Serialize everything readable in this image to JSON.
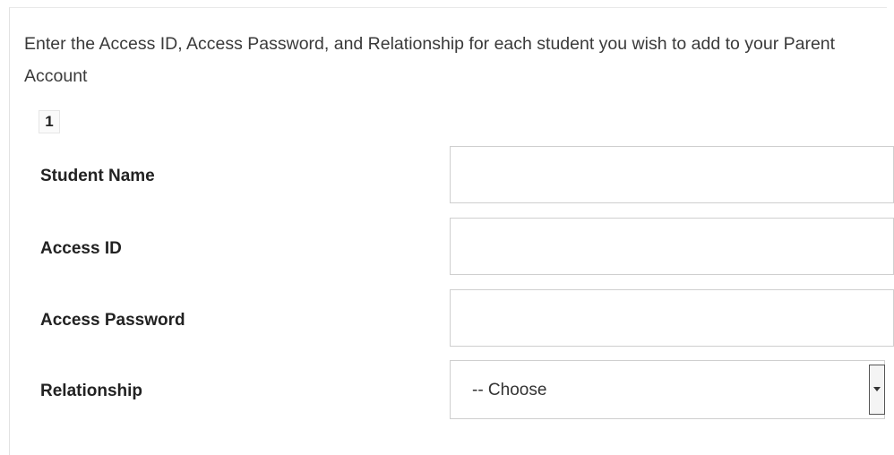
{
  "form": {
    "instructions": "Enter the Access ID, Access Password, and Relationship for each student you wish to add to your Parent Account",
    "student_number": "1",
    "fields": {
      "student_name": {
        "label": "Student Name",
        "value": ""
      },
      "access_id": {
        "label": "Access ID",
        "value": ""
      },
      "access_password": {
        "label": "Access Password",
        "value": ""
      },
      "relationship": {
        "label": "Relationship",
        "selected": "-- Choose"
      }
    }
  },
  "icons": {
    "dropdown": "chevron-down-icon"
  }
}
